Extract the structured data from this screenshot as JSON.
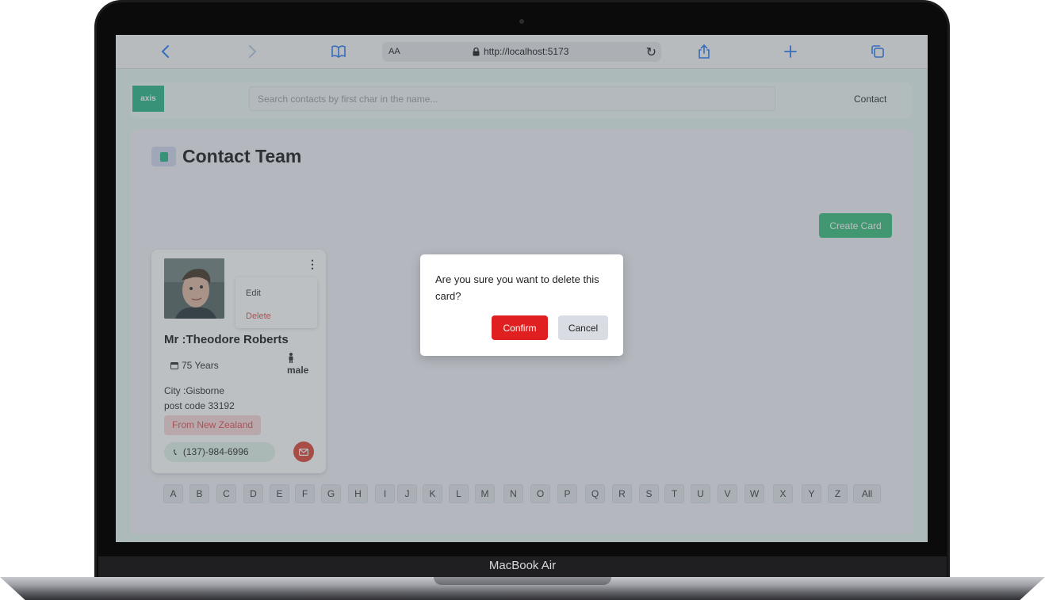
{
  "device": {
    "label": "MacBook Air"
  },
  "browser": {
    "text_size_label": "AA",
    "url": "http://localhost:5173"
  },
  "app": {
    "logo_text": "axis",
    "search_placeholder": "Search contacts by first char in the name...",
    "nav_link": "Contact",
    "page_title": "Contact Team",
    "create_button": "Create Card"
  },
  "card": {
    "menu": {
      "edit": "Edit",
      "delete": "Delete"
    },
    "name": "Mr :Theodore Roberts",
    "age": "75 Years",
    "gender": "male",
    "city": "City :Gisborne",
    "post_code": "post code 33192",
    "country": "From New Zealand",
    "phone": "(137)-984-6996"
  },
  "alphabet": [
    "A",
    "B",
    "C",
    "D",
    "E",
    "F",
    "G",
    "H",
    "I",
    "J",
    "K",
    "L",
    "M",
    "N",
    "O",
    "P",
    "Q",
    "R",
    "S",
    "T",
    "U",
    "V",
    "W",
    "X",
    "Y",
    "Z",
    "All"
  ],
  "modal": {
    "question": "Are you sure you want to delete this card?",
    "confirm": "Confirm",
    "cancel": "Cancel"
  },
  "colors": {
    "accent_green": "#3fbf7d",
    "danger_red": "#e02020",
    "safari_blue": "#2f7ef5"
  }
}
